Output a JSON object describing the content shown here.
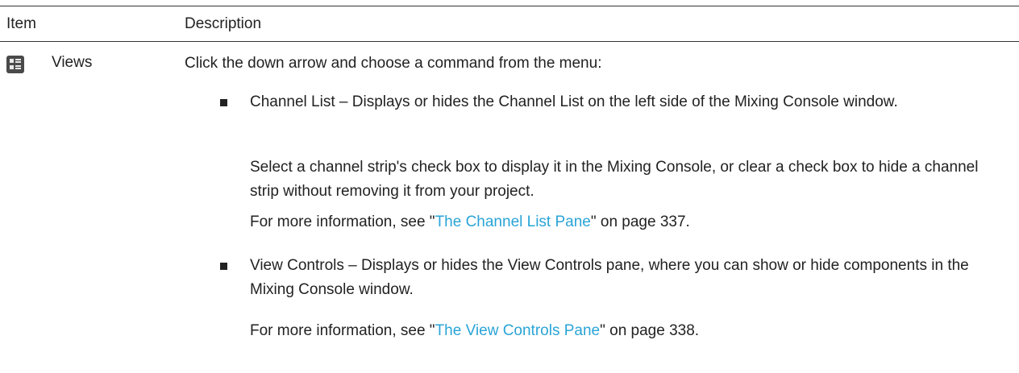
{
  "header": {
    "item": "Item",
    "description": "Description"
  },
  "row": {
    "icon": "views-icon",
    "name": "Views",
    "intro": "Click the down arrow and choose a command from the menu:",
    "bullets": [
      {
        "text": "Channel List – Displays or hides the Channel List on the left side of the Mixing Console window.",
        "paragraphs": [
          "Select a channel strip's check box to display it in the Mixing Console, or clear a check box to hide a channel strip without removing it from your project."
        ],
        "more": {
          "prefix": "For more information, see \"",
          "link": "The Channel List Pane",
          "suffix": "\" on page 337."
        }
      },
      {
        "text": "View Controls – Displays or hides the View Controls pane, where you can show or hide components in the Mixing Console window.",
        "paragraphs": [],
        "more": {
          "prefix": "For more information, see \"",
          "link": "The View Controls Pane",
          "suffix": "\" on page 338."
        }
      }
    ]
  },
  "colors": {
    "link": "#2aa4d6",
    "text": "#222222",
    "rule": "#333333"
  }
}
